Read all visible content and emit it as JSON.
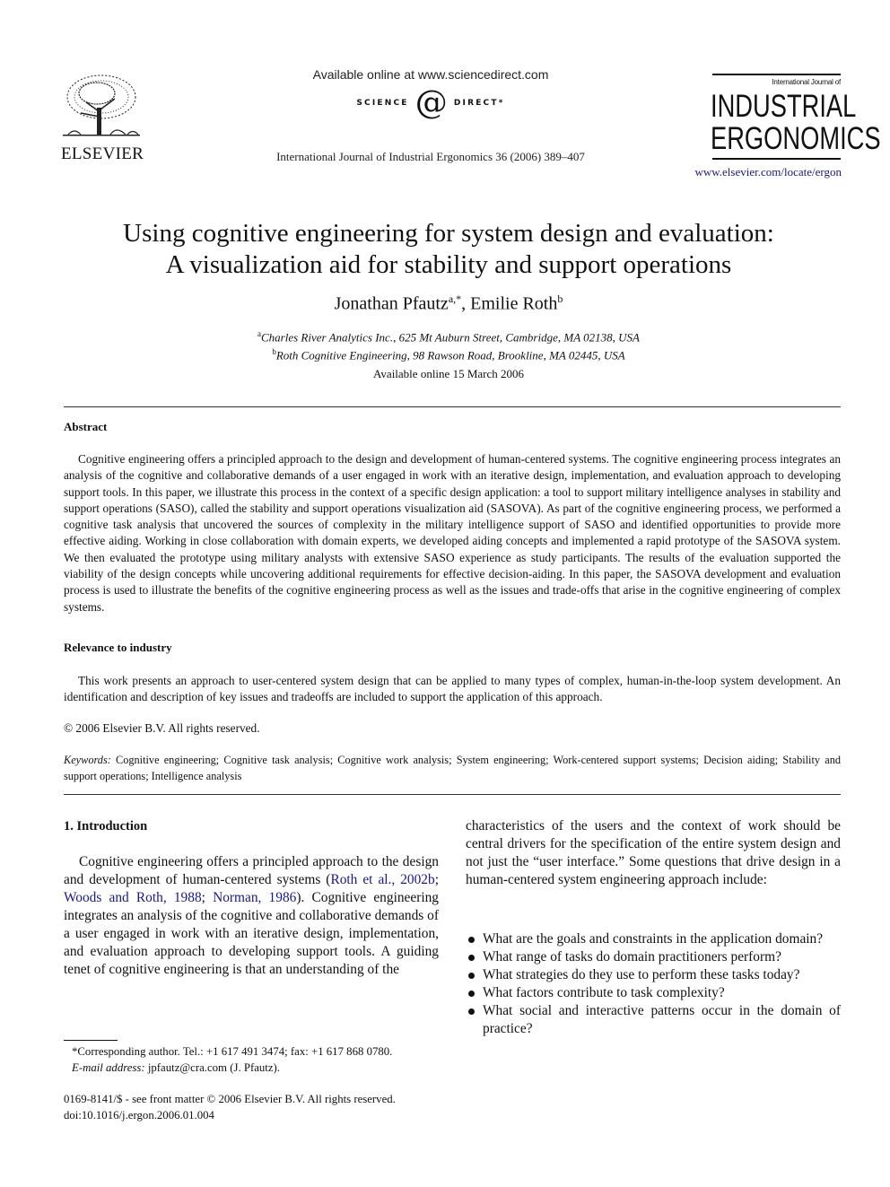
{
  "header": {
    "publisher_logo_text": "ELSEVIER",
    "available_online": "Available online at www.sciencedirect.com",
    "sciencedirect_left": "SCIENCE",
    "sciencedirect_at": "d",
    "sciencedirect_right": "DIRECT",
    "sciencedirect_mark": "*",
    "journal_citation": "International Journal of Industrial Ergonomics 36 (2006) 389–407",
    "journal_logo_small": "International Journal of",
    "journal_logo_line1": "INDUSTRIAL",
    "journal_logo_line2": "ERGONOMICS",
    "journal_url": "www.elsevier.com/locate/ergon"
  },
  "article": {
    "title_line1": "Using cognitive engineering for system design and evaluation:",
    "title_line2": "A visualization aid for stability and support operations",
    "authors": [
      {
        "name": "Jonathan Pfautz",
        "sup": "a,*"
      },
      {
        "name": "Emilie Roth",
        "sup": "b"
      }
    ],
    "author_separator": ", ",
    "affiliations": [
      {
        "sup": "a",
        "text": "Charles River Analytics Inc., 625 Mt Auburn Street, Cambridge, MA 02138, USA"
      },
      {
        "sup": "b",
        "text": "Roth Cognitive Engineering, 98 Rawson Road, Brookline, MA 02445, USA"
      }
    ],
    "available_date": "Available online 15 March 2006"
  },
  "abstract": {
    "heading": "Abstract",
    "body": "Cognitive engineering offers a principled approach to the design and development of human-centered systems. The cognitive engineering process integrates an analysis of the cognitive and collaborative demands of a user engaged in work with an iterative design, implementation, and evaluation approach to developing support tools. In this paper, we illustrate this process in the context of a specific design application: a tool to support military intelligence analyses in stability and support operations (SASO), called the stability and support operations visualization aid (SASOVA). As part of the cognitive engineering process, we performed a cognitive task analysis that uncovered the sources of complexity in the military intelligence support of SASO and identified opportunities to provide more effective aiding. Working in close collaboration with domain experts, we developed aiding concepts and implemented a rapid prototype of the SASOVA system. We then evaluated the prototype using military analysts with extensive SASO experience as study participants. The results of the evaluation supported the viability of the design concepts while uncovering additional requirements for effective decision-aiding. In this paper, the SASOVA development and evaluation process is used to illustrate the benefits of the cognitive engineering process as well as the issues and trade-offs that arise in the cognitive engineering of complex systems."
  },
  "relevance": {
    "heading": "Relevance to industry",
    "body": "This work presents an approach to user-centered system design that can be applied to many types of complex, human-in-the-loop system development. An identification and description of key issues and tradeoffs are included to support the application of this approach.",
    "copyright": "© 2006 Elsevier B.V. All rights reserved."
  },
  "keywords": {
    "label": "Keywords:",
    "text": "Cognitive engineering; Cognitive task analysis; Cognitive work analysis; System engineering; Work-centered support systems; Decision aiding; Stability and support operations; Intelligence analysis"
  },
  "introduction": {
    "heading": "1.  Introduction",
    "para1_start": "Cognitive engineering offers a principled approach to the design and development of human-centered systems (",
    "citations": [
      "Roth et al., 2002b",
      "Woods and Roth, 1988",
      "Norman, 1986"
    ],
    "citation_sep": "; ",
    "para1_end": "). Cognitive engineering integrates an analysis of the cognitive and collaborative demands of a user engaged in work with an iterative design, implementation, and evaluation approach to developing support tools. A guiding tenet of cognitive engineering is that an understanding of the characteristics of the users and the context of work should be central drivers for the specification of the entire system design and not just the “user interface.” Some questions that drive design in a human-centered system engineering approach include:",
    "col1_text_end": "). Cognitive engineering integrates an analysis of the cognitive and collaborative demands of a user engaged in work with an iterative design, implementation, and evaluation approach to developing support tools. A guiding tenet of cognitive engineering is that an understanding of the",
    "col2_text": "characteristics of the users and the context of work should be central drivers for the specification of the entire system design and not just the “user interface.” Some questions that drive design in a human-centered system engineering approach include:",
    "bullets": [
      "What are the goals and constraints in the application domain?",
      "What range of tasks do domain practitioners perform?",
      "What strategies do they use to perform these tasks today?",
      "What factors contribute to task complexity?",
      "What social and interactive patterns occur in the domain of practice?"
    ]
  },
  "footnotes": {
    "corresponding": "*Corresponding author. Tel.: +1 617 491 3474; fax: +1 617 868 0780.",
    "email_label": "E-mail address:",
    "email_value": " jpfautz@cra.com (J. Pfautz).",
    "front_matter": "0169-8141/$ - see front matter © 2006 Elsevier B.V. All rights reserved.",
    "doi": "doi:10.1016/j.ergon.2006.01.004"
  },
  "colors": {
    "link": "#1a1a80",
    "text": "#111111"
  }
}
